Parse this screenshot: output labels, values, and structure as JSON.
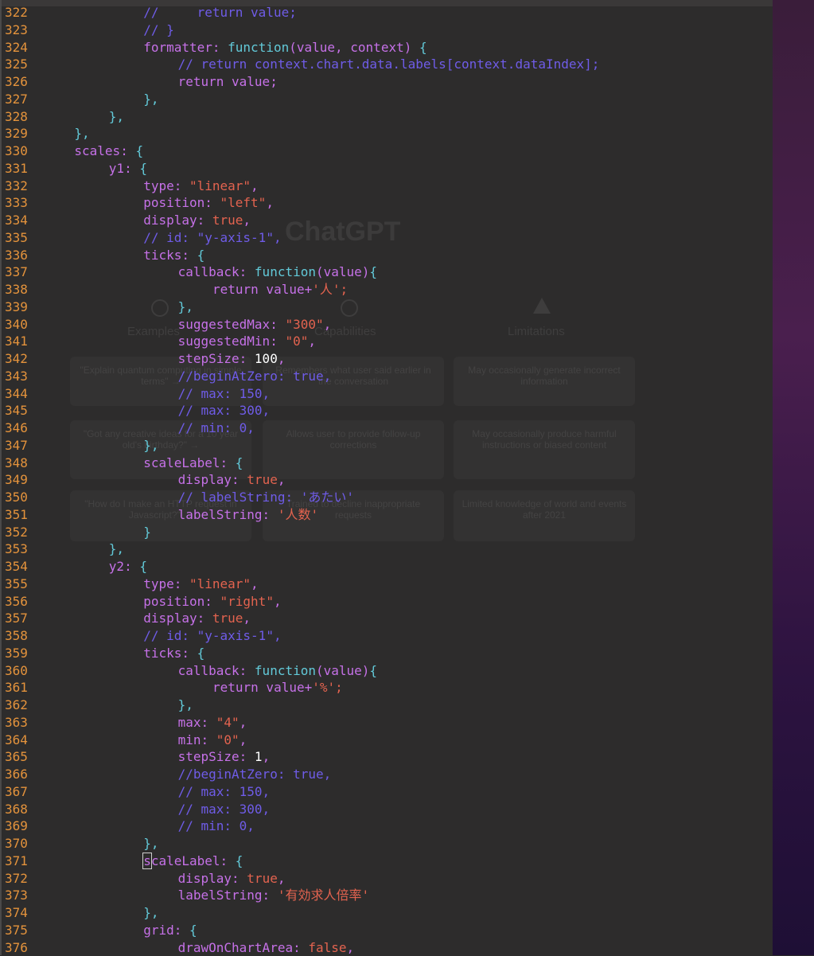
{
  "background": {
    "title": "ChatGPT",
    "columns": [
      "Examples",
      "Capabilities",
      "Limitations"
    ],
    "cards": [
      "\"Explain quantum computing in simple terms\" →",
      "Remembers what user said earlier in the conversation",
      "May occasionally generate incorrect information",
      "\"Got any creative ideas for a 10 year old's birthday?\" →",
      "Allows user to provide follow-up corrections",
      "May occasionally produce harmful instructions or biased content",
      "\"How do I make an HTTP request in Javascript?\" →",
      "Trained to decline inappropriate requests",
      "Limited knowledge of world and events after 2021"
    ]
  },
  "lines": [
    {
      "n": "322",
      "indent": 12,
      "tokens": [
        [
          "cmt",
          "//     return value;"
        ]
      ]
    },
    {
      "n": "323",
      "indent": 12,
      "tokens": [
        [
          "cmt",
          "// }"
        ]
      ]
    },
    {
      "n": "324",
      "indent": 12,
      "tokens": [
        [
          "kw-purple",
          "formatter: "
        ],
        [
          "fn",
          "function"
        ],
        [
          "kw-purple",
          "(value, context) "
        ],
        [
          "kw-cyan",
          "{"
        ]
      ]
    },
    {
      "n": "325",
      "indent": 16,
      "tokens": [
        [
          "cmt",
          "// return context.chart.data.labels[context.dataIndex];"
        ]
      ]
    },
    {
      "n": "326",
      "indent": 16,
      "tokens": [
        [
          "kw-purple",
          "return value;"
        ]
      ]
    },
    {
      "n": "327",
      "indent": 12,
      "tokens": [
        [
          "kw-cyan",
          "},"
        ]
      ]
    },
    {
      "n": "328",
      "indent": 8,
      "tokens": [
        [
          "kw-cyan",
          "},"
        ]
      ]
    },
    {
      "n": "329",
      "indent": 4,
      "tokens": [
        [
          "kw-cyan",
          "},"
        ]
      ]
    },
    {
      "n": "330",
      "indent": 4,
      "tokens": [
        [
          "kw-purple",
          "scales: "
        ],
        [
          "kw-cyan",
          "{"
        ]
      ]
    },
    {
      "n": "331",
      "indent": 8,
      "tokens": [
        [
          "kw-purple",
          "y1: "
        ],
        [
          "kw-cyan",
          "{"
        ]
      ]
    },
    {
      "n": "332",
      "indent": 12,
      "tokens": [
        [
          "kw-purple",
          "type: "
        ],
        [
          "str",
          "\"linear\""
        ],
        [
          "kw-purple",
          ","
        ]
      ]
    },
    {
      "n": "333",
      "indent": 12,
      "tokens": [
        [
          "kw-purple",
          "position: "
        ],
        [
          "str",
          "\"left\""
        ],
        [
          "kw-purple",
          ","
        ]
      ]
    },
    {
      "n": "334",
      "indent": 12,
      "tokens": [
        [
          "kw-purple",
          "display: "
        ],
        [
          "bool",
          "true"
        ],
        [
          "kw-purple",
          ","
        ]
      ]
    },
    {
      "n": "335",
      "indent": 12,
      "tokens": [
        [
          "cmt",
          "// id: \"y-axis-1\","
        ]
      ]
    },
    {
      "n": "336",
      "indent": 12,
      "tokens": [
        [
          "kw-purple",
          "ticks: "
        ],
        [
          "kw-cyan",
          "{"
        ]
      ]
    },
    {
      "n": "337",
      "indent": 16,
      "tokens": [
        [
          "kw-purple",
          "callback: "
        ],
        [
          "fn",
          "function"
        ],
        [
          "kw-purple",
          "(value)"
        ],
        [
          "kw-cyan",
          "{"
        ]
      ]
    },
    {
      "n": "338",
      "indent": 20,
      "tokens": [
        [
          "kw-purple",
          "return value+"
        ],
        [
          "str",
          "'人';"
        ]
      ]
    },
    {
      "n": "339",
      "indent": 16,
      "tokens": [
        [
          "kw-cyan",
          "},"
        ]
      ]
    },
    {
      "n": "340",
      "indent": 16,
      "tokens": [
        [
          "kw-purple",
          "suggestedMax: "
        ],
        [
          "str",
          "\"300\""
        ],
        [
          "kw-purple",
          ","
        ]
      ]
    },
    {
      "n": "341",
      "indent": 16,
      "tokens": [
        [
          "kw-purple",
          "suggestedMin: "
        ],
        [
          "str",
          "\"0\""
        ],
        [
          "kw-purple",
          ","
        ]
      ]
    },
    {
      "n": "342",
      "indent": 16,
      "tokens": [
        [
          "kw-purple",
          "stepSize: "
        ],
        [
          "num",
          "100"
        ],
        [
          "kw-purple",
          ","
        ]
      ]
    },
    {
      "n": "343",
      "indent": 16,
      "tokens": [
        [
          "cmt",
          "//beginAtZero: true,"
        ]
      ]
    },
    {
      "n": "344",
      "indent": 16,
      "tokens": [
        [
          "cmt",
          "// max: 150,"
        ]
      ]
    },
    {
      "n": "345",
      "indent": 16,
      "tokens": [
        [
          "cmt",
          "// max: 300,"
        ]
      ]
    },
    {
      "n": "346",
      "indent": 16,
      "tokens": [
        [
          "cmt",
          "// min: 0,"
        ]
      ]
    },
    {
      "n": "347",
      "indent": 12,
      "tokens": [
        [
          "kw-cyan",
          "},"
        ]
      ]
    },
    {
      "n": "348",
      "indent": 12,
      "tokens": [
        [
          "kw-purple",
          "scaleLabel: "
        ],
        [
          "kw-cyan",
          "{"
        ]
      ]
    },
    {
      "n": "349",
      "indent": 16,
      "tokens": [
        [
          "kw-purple",
          "display: "
        ],
        [
          "bool",
          "true"
        ],
        [
          "kw-purple",
          ","
        ]
      ]
    },
    {
      "n": "350",
      "indent": 16,
      "tokens": [
        [
          "cmt",
          "// labelString: 'あたい'"
        ]
      ]
    },
    {
      "n": "351",
      "indent": 16,
      "tokens": [
        [
          "kw-purple",
          "labelString: "
        ],
        [
          "str",
          "'人数'"
        ]
      ]
    },
    {
      "n": "352",
      "indent": 12,
      "tokens": [
        [
          "kw-cyan",
          "}"
        ]
      ]
    },
    {
      "n": "353",
      "indent": 8,
      "tokens": [
        [
          "kw-cyan",
          "},"
        ]
      ]
    },
    {
      "n": "354",
      "indent": 8,
      "tokens": [
        [
          "kw-purple",
          "y2: "
        ],
        [
          "kw-cyan",
          "{"
        ]
      ]
    },
    {
      "n": "355",
      "indent": 12,
      "tokens": [
        [
          "kw-purple",
          "type: "
        ],
        [
          "str",
          "\"linear\""
        ],
        [
          "kw-purple",
          ","
        ]
      ]
    },
    {
      "n": "356",
      "indent": 12,
      "tokens": [
        [
          "kw-purple",
          "position: "
        ],
        [
          "str",
          "\"right\""
        ],
        [
          "kw-purple",
          ","
        ]
      ]
    },
    {
      "n": "357",
      "indent": 12,
      "tokens": [
        [
          "kw-purple",
          "display: "
        ],
        [
          "bool",
          "true"
        ],
        [
          "kw-purple",
          ","
        ]
      ]
    },
    {
      "n": "358",
      "indent": 12,
      "tokens": [
        [
          "cmt",
          "// id: \"y-axis-1\","
        ]
      ]
    },
    {
      "n": "359",
      "indent": 12,
      "tokens": [
        [
          "kw-purple",
          "ticks: "
        ],
        [
          "kw-cyan",
          "{"
        ]
      ]
    },
    {
      "n": "360",
      "indent": 16,
      "tokens": [
        [
          "kw-purple",
          "callback: "
        ],
        [
          "fn",
          "function"
        ],
        [
          "kw-purple",
          "(value)"
        ],
        [
          "kw-cyan",
          "{"
        ]
      ]
    },
    {
      "n": "361",
      "indent": 20,
      "tokens": [
        [
          "kw-purple",
          "return value+"
        ],
        [
          "str",
          "'%';"
        ]
      ]
    },
    {
      "n": "362",
      "indent": 16,
      "tokens": [
        [
          "kw-cyan",
          "},"
        ]
      ]
    },
    {
      "n": "363",
      "indent": 16,
      "tokens": [
        [
          "kw-purple",
          "max: "
        ],
        [
          "str",
          "\"4\""
        ],
        [
          "kw-purple",
          ","
        ]
      ]
    },
    {
      "n": "364",
      "indent": 16,
      "tokens": [
        [
          "kw-purple",
          "min: "
        ],
        [
          "str",
          "\"0\""
        ],
        [
          "kw-purple",
          ","
        ]
      ]
    },
    {
      "n": "365",
      "indent": 16,
      "tokens": [
        [
          "kw-purple",
          "stepSize: "
        ],
        [
          "num",
          "1"
        ],
        [
          "kw-purple",
          ","
        ]
      ]
    },
    {
      "n": "366",
      "indent": 16,
      "tokens": [
        [
          "cmt",
          "//beginAtZero: true,"
        ]
      ]
    },
    {
      "n": "367",
      "indent": 16,
      "tokens": [
        [
          "cmt",
          "// max: 150,"
        ]
      ]
    },
    {
      "n": "368",
      "indent": 16,
      "tokens": [
        [
          "cmt",
          "// max: 300,"
        ]
      ]
    },
    {
      "n": "369",
      "indent": 16,
      "tokens": [
        [
          "cmt",
          "// min: 0,"
        ]
      ]
    },
    {
      "n": "370",
      "indent": 12,
      "tokens": [
        [
          "kw-cyan",
          "},"
        ]
      ]
    },
    {
      "n": "371",
      "indent": 12,
      "tokens": [
        [
          "kw-purple",
          "scaleLabel: "
        ],
        [
          "kw-cyan",
          "{"
        ]
      ],
      "cursor": true
    },
    {
      "n": "372",
      "indent": 16,
      "tokens": [
        [
          "kw-purple",
          "display: "
        ],
        [
          "bool",
          "true"
        ],
        [
          "kw-purple",
          ","
        ]
      ]
    },
    {
      "n": "373",
      "indent": 16,
      "tokens": [
        [
          "kw-purple",
          "labelString: "
        ],
        [
          "str",
          "'有効求人倍率'"
        ]
      ]
    },
    {
      "n": "374",
      "indent": 12,
      "tokens": [
        [
          "kw-cyan",
          "},"
        ]
      ]
    },
    {
      "n": "375",
      "indent": 12,
      "tokens": [
        [
          "kw-purple",
          "grid: "
        ],
        [
          "kw-cyan",
          "{"
        ]
      ]
    },
    {
      "n": "376",
      "indent": 16,
      "tokens": [
        [
          "kw-purple",
          "drawOnChartArea: "
        ],
        [
          "bool",
          "false"
        ],
        [
          "kw-purple",
          ","
        ]
      ]
    }
  ]
}
